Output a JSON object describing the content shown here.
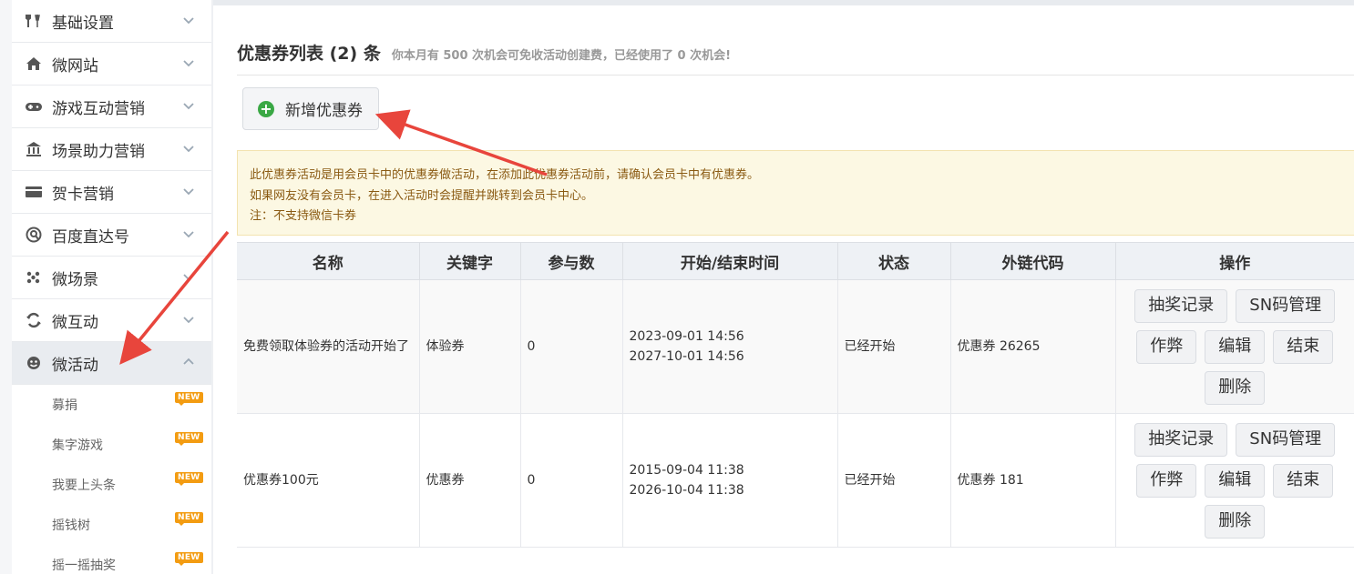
{
  "sidebar": {
    "menu": [
      {
        "label": "基础设置",
        "icon": "tools-icon"
      },
      {
        "label": "微网站",
        "icon": "home-icon"
      },
      {
        "label": "游戏互动营销",
        "icon": "gamepad-icon"
      },
      {
        "label": "场景助力营销",
        "icon": "bank-icon"
      },
      {
        "label": "贺卡营销",
        "icon": "card-icon"
      },
      {
        "label": "百度直达号",
        "icon": "baidu-icon"
      },
      {
        "label": "微场景",
        "icon": "dots-icon"
      },
      {
        "label": "微互动",
        "icon": "interact-icon"
      },
      {
        "label": "微活动",
        "icon": "activity-icon"
      }
    ],
    "submenu": [
      {
        "label": "募捐",
        "badge": "NEW"
      },
      {
        "label": "集字游戏",
        "badge": "NEW"
      },
      {
        "label": "我要上头条",
        "badge": "NEW"
      },
      {
        "label": "摇钱树",
        "badge": "NEW"
      },
      {
        "label": "摇一摇抽奖",
        "badge": "NEW"
      }
    ]
  },
  "header": {
    "title": "优惠券列表 (2) 条",
    "subtitle": "你本月有 500 次机会可免收活动创建费，已经使用了 0 次机会!"
  },
  "add_button": {
    "label": "新增优惠券",
    "icon": "plus-circle-icon"
  },
  "notice": {
    "lines": [
      "此优惠券活动是用会员卡中的优惠券做活动，在添加此优惠券活动前，请确认会员卡中有优惠券。",
      "如果网友没有会员卡，在进入活动时会提醒并跳转到会员卡中心。",
      "注：不支持微信卡券"
    ]
  },
  "table": {
    "columns": [
      "名称",
      "关键字",
      "参与数",
      "开始/结束时间",
      "状态",
      "外链代码",
      "操作"
    ],
    "rows": [
      {
        "name": "免费领取体验券的活动开始了",
        "keyword": "体验券",
        "participants": "0",
        "start": "2023-09-01 14:56",
        "end": "2027-10-01 14:56",
        "status": "已经开始",
        "link": "优惠券 26265"
      },
      {
        "name": "优惠券100元",
        "keyword": "优惠券",
        "participants": "0",
        "start": "2015-09-04 11:38",
        "end": "2026-10-04 11:38",
        "status": "已经开始",
        "link": "优惠券 181"
      }
    ],
    "actions": {
      "lottery": "抽奖记录",
      "sn": "SN码管理",
      "cheat": "作弊",
      "edit": "编辑",
      "end": "结束",
      "delete": "删除"
    }
  },
  "colors": {
    "accent_arrow": "#e8453c",
    "status_green": "#3d9b2f",
    "badge": "#f39c12"
  }
}
